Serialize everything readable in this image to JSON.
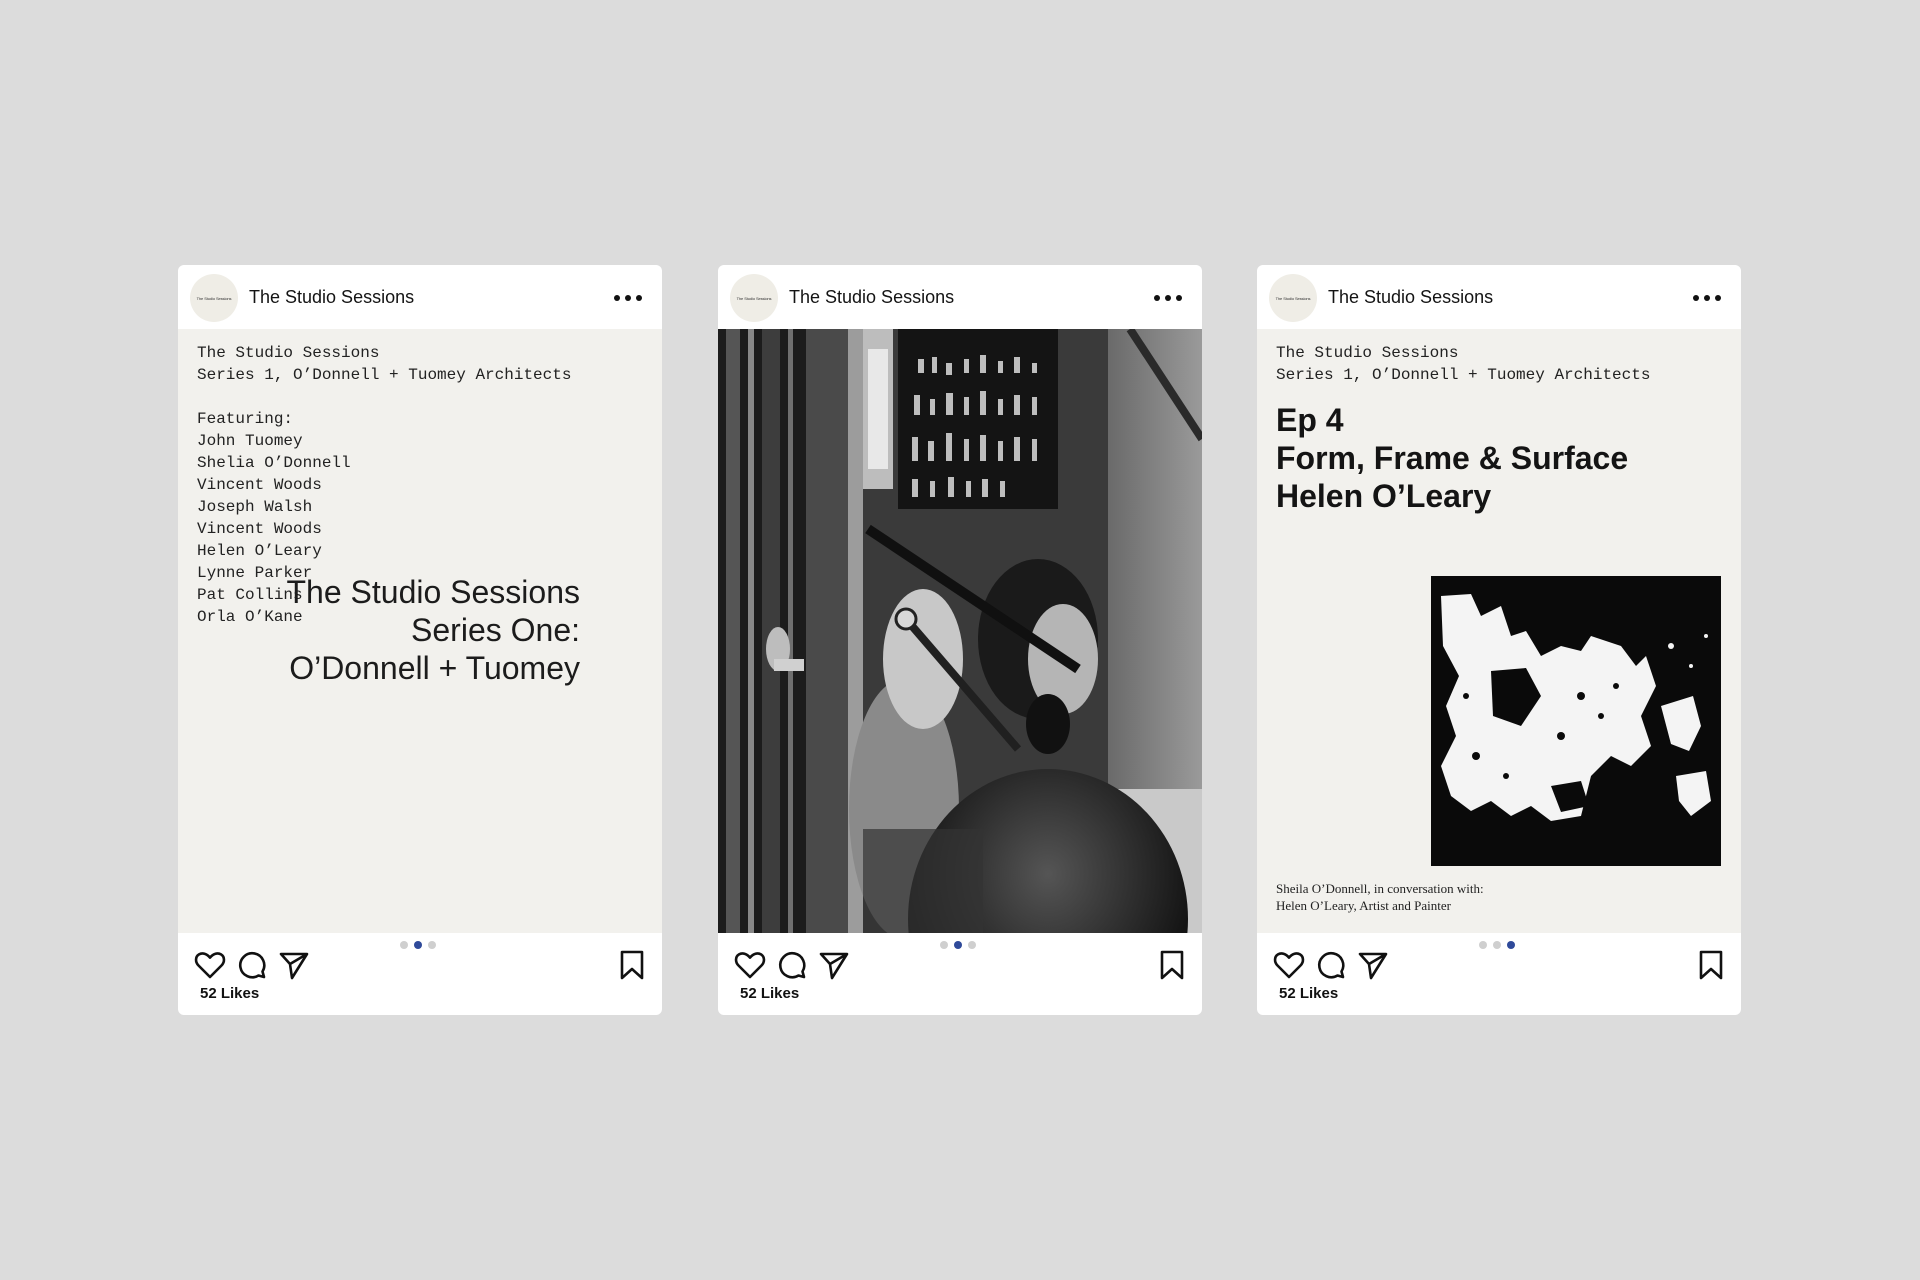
{
  "posts": [
    {
      "account": "The Studio Sessions",
      "avatar_text": "The Studio Sessions",
      "intro": [
        "The Studio Sessions",
        "Series 1, O’Donnell + Tuomey Architects"
      ],
      "featuring_heading": "Featuring:",
      "featuring": [
        "John Tuomey",
        "Shelia O’Donnell",
        "Vincent Woods",
        "Joseph Walsh",
        "Vincent Woods",
        "Helen O’Leary",
        "Lynne Parker",
        "Pat Collins",
        "Orla O’Kane"
      ],
      "overlay_title": [
        "The Studio Sessions",
        "Series One:",
        "O’Donnell + Tuomey"
      ],
      "likes": "52 Likes",
      "active_slide": 1,
      "slide_count": 3
    },
    {
      "account": "The Studio Sessions",
      "avatar_text": "The Studio Sessions",
      "likes": "52 Likes",
      "active_slide": 1,
      "slide_count": 3
    },
    {
      "account": "The Studio Sessions",
      "avatar_text": "The Studio Sessions",
      "intro": [
        "The Studio Sessions",
        "Series 1, O’Donnell + Tuomey Architects"
      ],
      "episode_title": [
        "Ep 4",
        "Form, Frame & Surface",
        "Helen O’Leary"
      ],
      "caption": [
        "Sheila O’Donnell, in conversation with:",
        "Helen O’Leary, Artist and Painter"
      ],
      "likes": "52 Likes",
      "active_slide": 2,
      "slide_count": 3
    }
  ],
  "colors": {
    "page_bg": "#dcdcdc",
    "card_bg": "#ffffff",
    "media_bg": "#f2f1ed",
    "active_dot": "#2f4a9a",
    "inactive_dot": "#cfcfcf"
  },
  "icons": [
    "heart-icon",
    "comment-icon",
    "share-icon",
    "bookmark-icon",
    "more-options-icon"
  ]
}
